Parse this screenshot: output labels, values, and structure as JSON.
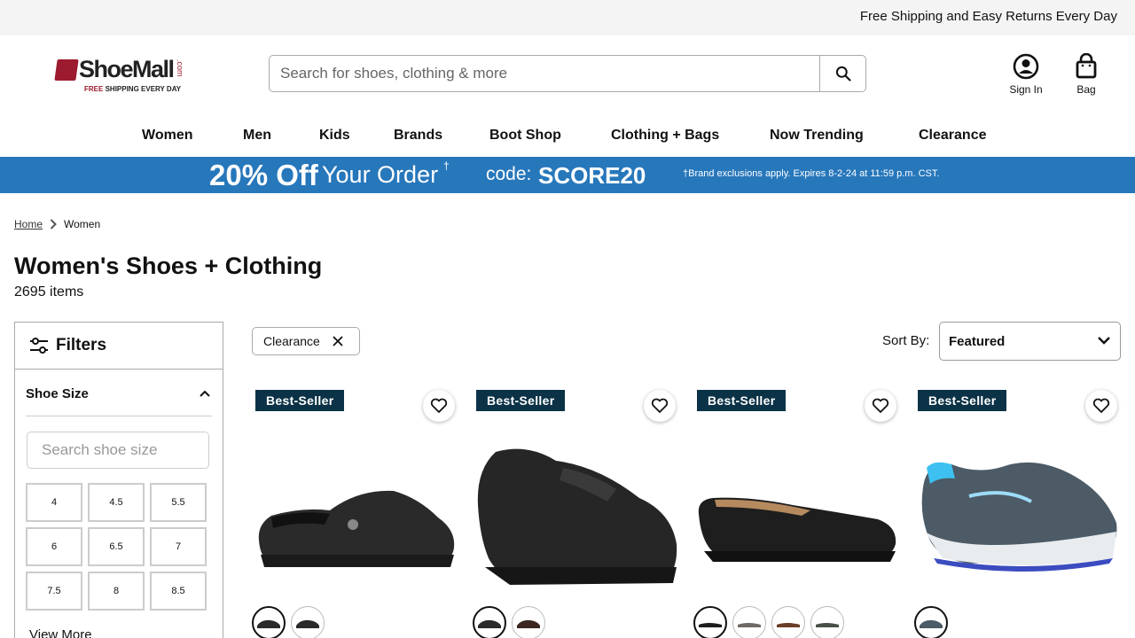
{
  "announcement": "Free Shipping and Easy Returns Every Day",
  "logo": {
    "brand": "ShoeMall",
    "dotcom": ".com",
    "tag_free": "FREE",
    "tag_rest": "SHIPPING EVERY DAY"
  },
  "search": {
    "placeholder": "Search for shoes, clothing & more"
  },
  "header": {
    "sign_in": "Sign In",
    "bag": "Bag"
  },
  "nav": [
    "Women",
    "Men",
    "Kids",
    "Brands",
    "Boot Shop",
    "Clothing + Bags",
    "Now Trending",
    "Clearance"
  ],
  "promo": {
    "big": "20% Off",
    "your_order": "Your Order",
    "dagger": "†",
    "code_label": "code:",
    "code": "SCORE20",
    "fine": "†Brand exclusions apply. Expires 8-2-24 at 11:59 p.m. CST."
  },
  "breadcrumb": {
    "home": "Home",
    "current": "Women"
  },
  "page": {
    "title": "Women's Shoes + Clothing",
    "count": "2695 items"
  },
  "filters": {
    "title": "Filters",
    "section": "Shoe Size",
    "size_placeholder": "Search shoe size",
    "sizes": [
      "4",
      "4.5",
      "5.5",
      "6",
      "6.5",
      "7",
      "7.5",
      "8",
      "8.5"
    ],
    "view_more": "View More"
  },
  "active_filter": "Clearance",
  "sort": {
    "label": "Sort By:",
    "value": "Featured"
  },
  "products": [
    {
      "badge": "Best-Seller",
      "swatches": 2,
      "color": "#2a2a2a"
    },
    {
      "badge": "Best-Seller",
      "swatches": 2,
      "color": "#262626"
    },
    {
      "badge": "Best-Seller",
      "swatches": 4,
      "color": "#1e1e1e"
    },
    {
      "badge": "Best-Seller",
      "swatches": 1,
      "color": "#4c5b66"
    }
  ],
  "colors": {
    "promo": "#2777bb",
    "badge": "#0b3246",
    "brand": "#9c1b2f"
  }
}
